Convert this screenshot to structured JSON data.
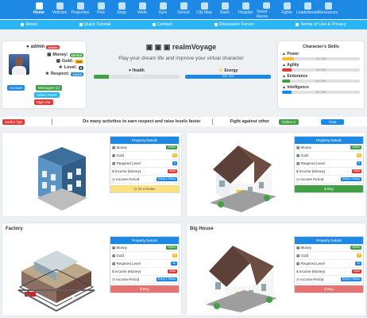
{
  "nav": {
    "items": [
      "Home",
      "Vehicles",
      "Properties",
      "Pets",
      "Shop",
      "Work",
      "Gym",
      "School",
      "City Map",
      "Bank",
      "Hospital",
      "Street Races",
      "Fights",
      "Leaderboard",
      "Resources"
    ]
  },
  "subnav": [
    "About",
    "Quick Tutorial",
    "Contact",
    "Discussion Forum",
    "Terms of Use & Privacy"
  ],
  "profile": {
    "username": "admin",
    "role_badge": "Admin",
    "money_label": "Money:",
    "money_value": "687515",
    "gold_label": "Gold:",
    "gold_value": "389",
    "level_label": "Level:",
    "level_value": "9",
    "respect_label": "Respect:",
    "respect_value": "111/16",
    "btn_account": "Account",
    "btn_messages": "Messages (1)",
    "btn_admin": "Admin Panel",
    "btn_signout": "Sign Out"
  },
  "center": {
    "brand": "realmVoyage",
    "tagline": "Play your dream life and improve your virtual character",
    "health_label": "Health",
    "health_text": "100 / 100",
    "health_pct": 18,
    "energy_label": "Energy",
    "energy_text": "100 / 100",
    "energy_pct": 100
  },
  "skills": {
    "title": "Character's Skills",
    "items": [
      {
        "label": "Power",
        "text": "75 / 100",
        "pct": 15,
        "color": "#fbc02d"
      },
      {
        "label": "Agility",
        "text": "76 / 100",
        "pct": 12,
        "color": "#e53935"
      },
      {
        "label": "Endurance",
        "text": "24 / 100",
        "pct": 10,
        "color": "#43a047"
      },
      {
        "label": "Intelligence",
        "text": "41 / 100",
        "pct": 12,
        "color": "#1e88e5"
      }
    ]
  },
  "ticker": {
    "tips": "Useful Tips",
    "message": "Do many activities to earn respect and raise levels faster",
    "fight": "Fight against other",
    "online": "Online",
    "online_count": "0",
    "chat": "Chat"
  },
  "cards": [
    {
      "title": "",
      "details_title": "Property Details",
      "rows": [
        {
          "label": "Money",
          "value": "10000",
          "color": "#43a047"
        },
        {
          "label": "Gold",
          "value": "2",
          "color": "#fbc02d"
        },
        {
          "label": "Required Level",
          "value": "4",
          "color": "#1e88e5"
        },
        {
          "label": "Income (Money)",
          "value": "5000",
          "color": "#e53935"
        },
        {
          "label": "Income Period",
          "value": "Every 1 Hours",
          "color": "#1e88e5"
        }
      ],
      "action": "20 minutes",
      "action_color": "#ffe082"
    },
    {
      "title": "",
      "details_title": "Property Details",
      "rows": [
        {
          "label": "Money",
          "value": "10000",
          "color": "#43a047"
        },
        {
          "label": "Gold",
          "value": "4",
          "color": "#fbc02d"
        },
        {
          "label": "Required Level",
          "value": "6",
          "color": "#1e88e5"
        },
        {
          "label": "Income (Money)",
          "value": "2000",
          "color": "#e53935"
        },
        {
          "label": "Income Period",
          "value": "Every 1 Hours",
          "color": "#1e88e5"
        }
      ],
      "action": "Buy",
      "action_color": "#43a047"
    },
    {
      "title": "Factory",
      "details_title": "Property Details",
      "rows": [
        {
          "label": "Money",
          "value": "20000",
          "color": "#43a047"
        },
        {
          "label": "Gold",
          "value": "3",
          "color": "#fbc02d"
        },
        {
          "label": "Required Level",
          "value": "12",
          "color": "#1e88e5"
        },
        {
          "label": "Income (Money)",
          "value": "3000",
          "color": "#e53935"
        },
        {
          "label": "Income Period",
          "value": "Every 1 Hours",
          "color": "#1e88e5"
        }
      ],
      "action": "Buy",
      "action_color": "#e57373"
    },
    {
      "title": "Big House",
      "details_title": "Property Details",
      "rows": [
        {
          "label": "Money",
          "value": "40000",
          "color": "#43a047"
        },
        {
          "label": "Gold",
          "value": "7",
          "color": "#fbc02d"
        },
        {
          "label": "Required Level",
          "value": "14",
          "color": "#1e88e5"
        },
        {
          "label": "Income (Money)",
          "value": "4000",
          "color": "#e53935"
        },
        {
          "label": "Income Period",
          "value": "Every 1 Hours",
          "color": "#1e88e5"
        }
      ],
      "action": "Buy",
      "action_color": "#e57373"
    }
  ]
}
